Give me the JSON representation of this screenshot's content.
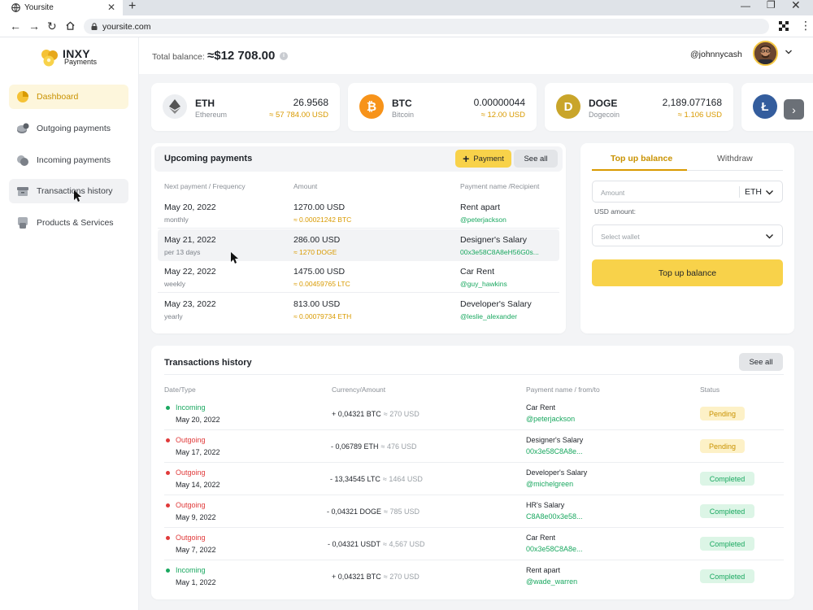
{
  "browser": {
    "tab_title": "Yoursite",
    "url": "yoursite.com"
  },
  "brand": {
    "name": "INXY",
    "sub": "Payments",
    "accent": "#f8d24a"
  },
  "sidebar": {
    "items": [
      {
        "label": "Dashboard",
        "icon": "pie-chart-icon",
        "active": true
      },
      {
        "label": "Outgoing payments",
        "icon": "outgoing-coins-icon"
      },
      {
        "label": "Incoming payments",
        "icon": "incoming-coins-icon"
      },
      {
        "label": "Transactions history",
        "icon": "archive-box-icon"
      },
      {
        "label": "Products & Services",
        "icon": "products-icon"
      }
    ]
  },
  "header": {
    "balance_label": "Total balance:",
    "balance_value": "≈$12 708.00",
    "username": "@johnnycash"
  },
  "coins": [
    {
      "symbol": "ETH",
      "name": "Ethereum",
      "amount": "26.9568",
      "usd": "≈ 57 784.00 USD",
      "color": "#eceef1"
    },
    {
      "symbol": "BTC",
      "name": "Bitcoin",
      "amount": "0.00000044",
      "usd": "≈ 12.00 USD",
      "color": "#f7931a"
    },
    {
      "symbol": "DOGE",
      "name": "Dogecoin",
      "amount": "2,189.077168",
      "usd": "≈ 1.106 USD",
      "color": "#c9a52a"
    }
  ],
  "upcoming": {
    "title": "Upcoming payments",
    "payment_btn": "Payment",
    "see_all": "See all",
    "columns": [
      "Next payment / Frequency",
      "Amount",
      "Payment name /Recipient"
    ],
    "rows": [
      {
        "date": "May 20, 2022",
        "freq": "monthly",
        "amount": "1270.00 USD",
        "crypto": "≈ 0.00021242 BTC",
        "name": "Rent apart",
        "recipient": "@peterjackson"
      },
      {
        "date": "May 21, 2022",
        "freq": "per 13 days",
        "amount": "286.00 USD",
        "crypto": "≈ 1270 DOGE",
        "name": "Designer's Salary",
        "recipient": "00x3e58C8A8eH56G0s..."
      },
      {
        "date": "May 22, 2022",
        "freq": "weekly",
        "amount": "1475.00 USD",
        "crypto": "≈ 0.00459765 LTC",
        "name": "Car Rent",
        "recipient": "@guy_hawkins"
      },
      {
        "date": "May 23, 2022",
        "freq": "yearly",
        "amount": "813.00 USD",
        "crypto": "≈ 0.00079734 ETH",
        "name": "Developer's Salary",
        "recipient": "@leslie_alexander"
      }
    ]
  },
  "topup": {
    "tab_active": "Top up balance",
    "tab_other": "Withdraw",
    "amount_placeholder": "Amount",
    "currency": "ETH",
    "usd_label": "USD amount:",
    "wallet_placeholder": "Select wallet",
    "button": "Top up balance"
  },
  "transactions": {
    "title": "Transactions history",
    "see_all": "See all",
    "columns": [
      "Date/Type",
      "Currency/Amount",
      "Payment name / from/to",
      "Status"
    ],
    "rows": [
      {
        "type": "Incoming",
        "dir": "in",
        "date": "May 20, 2022",
        "amount": "+ 0,04321 BTC",
        "usd": "≈ 270 USD",
        "name": "Car Rent",
        "party": "@peterjackson",
        "status": "Pending"
      },
      {
        "type": "Outgoing",
        "dir": "out",
        "date": "May 17, 2022",
        "amount": "- 0,06789 ETH",
        "usd": "≈ 476 USD",
        "name": "Designer's Salary",
        "party": "00x3e58C8A8e...",
        "status": "Pending"
      },
      {
        "type": "Outgoing",
        "dir": "out",
        "date": "May 14, 2022",
        "amount": "- 13,34545 LTC",
        "usd": "≈ 1464 USD",
        "name": "Developer's Salary",
        "party": "@michelgreen",
        "status": "Completed"
      },
      {
        "type": "Outgoing",
        "dir": "out",
        "date": "May 9, 2022",
        "amount": "- 0,04321 DOGE",
        "usd": "≈ 785 USD",
        "name": "HR's Salary",
        "party": "C8A8e00x3e58...",
        "status": "Completed"
      },
      {
        "type": "Outgoing",
        "dir": "out",
        "date": "May 7, 2022",
        "amount": "- 0,04321 USDT",
        "usd": "≈ 4,567 USD",
        "name": "Car Rent",
        "party": "00x3e58C8A8e...",
        "status": "Completed"
      },
      {
        "type": "Incoming",
        "dir": "in",
        "date": "May 1, 2022",
        "amount": "+ 0,04321 BTC",
        "usd": "≈ 270 USD",
        "name": "Rent apart",
        "party": "@wade_warren",
        "status": "Completed"
      }
    ]
  }
}
